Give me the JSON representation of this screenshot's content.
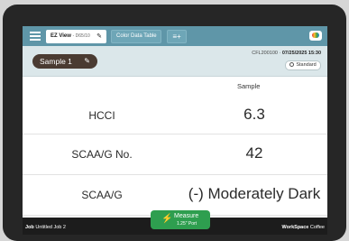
{
  "tabs": [
    {
      "label": "EZ View",
      "sub": "D65/10"
    },
    {
      "label": "Color Data Table"
    }
  ],
  "header": {
    "sample_label": "Sample 1",
    "instrument_id": "CFL200100",
    "datetime": "07/25/2025 15:30",
    "standard_label": "Standard"
  },
  "table": {
    "column_header": "Sample",
    "rows": [
      {
        "label": "HCCI",
        "value": "6.3"
      },
      {
        "label": "SCAA/G No.",
        "value": "42"
      },
      {
        "label": "SCAA/G",
        "value": "(-) Moderately Dark"
      }
    ]
  },
  "footer": {
    "job_key": "Job",
    "job_value": "Untitled Job 2",
    "workspace_key": "WorkSpace",
    "workspace_value": "Coffee"
  },
  "measure": {
    "label": "Measure",
    "sub": "1.25\" Port"
  },
  "icons": [
    "menu-icon",
    "pencil-icon",
    "add-tab-icon",
    "camera-icon",
    "lightning-icon",
    "radio-icon"
  ],
  "colors": {
    "topbar": "#5f96a8",
    "header": "#dbe7ea",
    "chip": "#4a3b32",
    "measure": "#2e9e4f",
    "footer": "#1c1c1c"
  }
}
